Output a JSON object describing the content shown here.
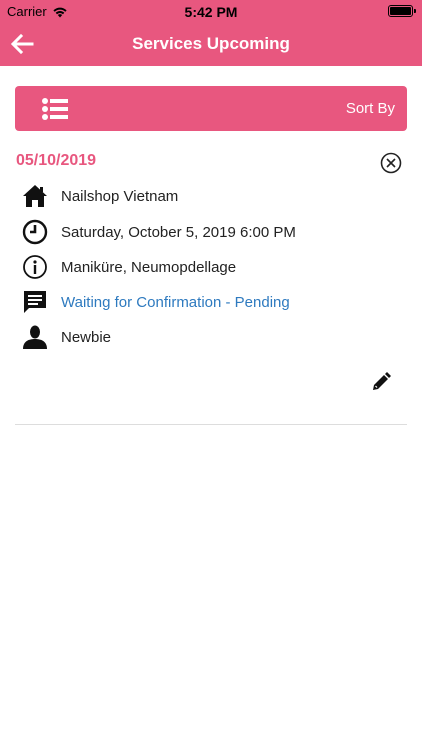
{
  "status_bar": {
    "carrier": "Carrier",
    "time": "5:42 PM"
  },
  "nav": {
    "title": "Services Upcoming"
  },
  "toolbar": {
    "sort_label": "Sort By"
  },
  "appointment": {
    "date": "05/10/2019",
    "shop": "Nailshop Vietnam",
    "datetime": "Saturday, October 5, 2019 6:00 PM",
    "services": "Maniküre, Neumopdellage",
    "status": "Waiting for Confirmation - Pending",
    "staff": "Newbie"
  },
  "colors": {
    "accent": "#e8577f",
    "status_text": "#2e7abf"
  }
}
